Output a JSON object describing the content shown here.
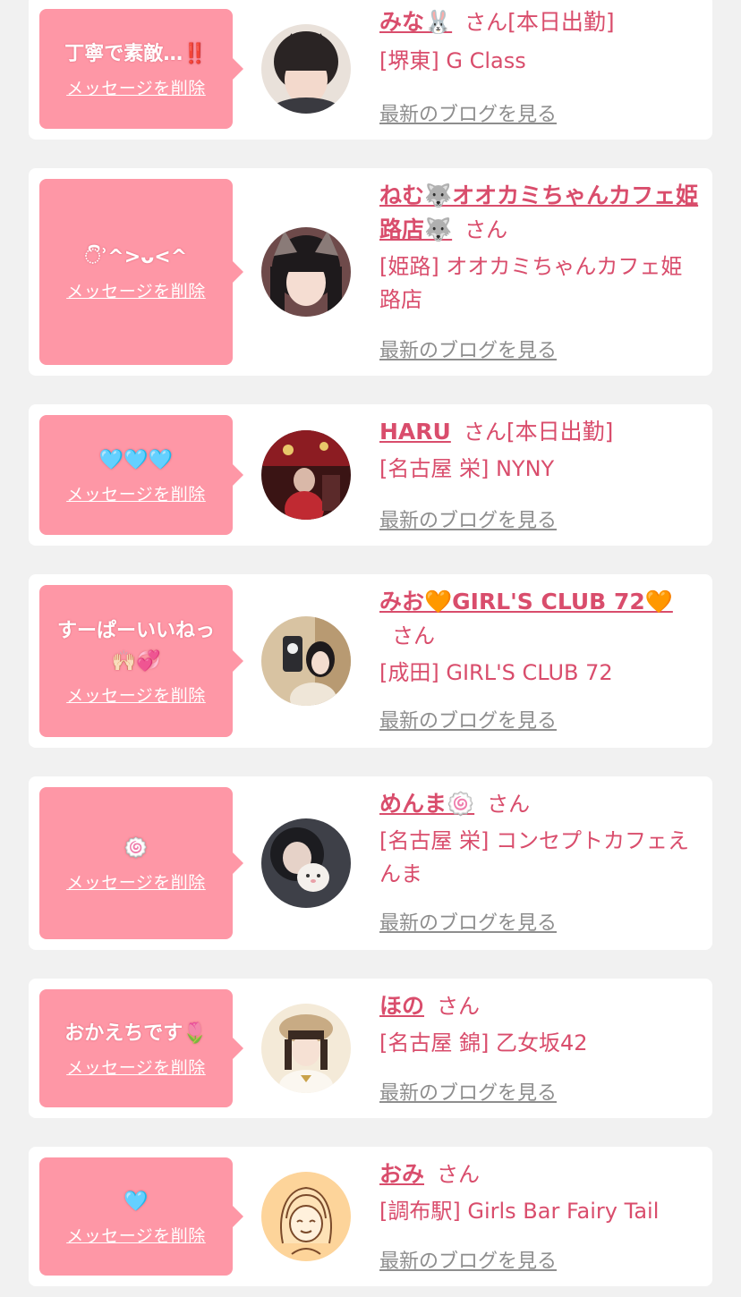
{
  "delete_label": "メッセージを削除",
  "blog_label": "最新のブログを見る",
  "san_label": "さん",
  "colors": {
    "background": "#f1f1f1",
    "card": "#ffffff",
    "bubble": "#fe97a6",
    "accent": "#d94d6c",
    "link_gray": "#8e8e8e"
  },
  "entries": [
    {
      "message": "丁寧で素敵…‼️",
      "name": "みな🐰",
      "status": "[本日出勤]",
      "shop": "[堺東] G Class",
      "avatar_icon": "user-photo-icon"
    },
    {
      "message": "ිʾ^>ᴗ<^",
      "name": "ねむ🐺オオカミちゃんカフェ姫路店🐺",
      "status": "",
      "shop": "[姫路] オオカミちゃんカフェ姫路店",
      "avatar_icon": "user-photo-icon"
    },
    {
      "message": "🩵🩵🩵",
      "name": "HARU",
      "status": "[本日出勤]",
      "shop": "[名古屋 栄] NYNY",
      "avatar_icon": "user-photo-icon"
    },
    {
      "message": "すーぱーいいねっ🙌🏻💞",
      "name": "みお🧡GIRL'S CLUB 72🧡",
      "status": "",
      "shop": "[成田] GIRL'S CLUB 72",
      "avatar_icon": "user-photo-icon"
    },
    {
      "message": "🍥",
      "name": "めんま🍥",
      "status": "",
      "shop": "[名古屋 栄] コンセプトカフェえんま",
      "avatar_icon": "user-photo-icon"
    },
    {
      "message": "おかえちです🌷",
      "name": "ほの",
      "status": "",
      "shop": "[名古屋 錦] 乙女坂42",
      "avatar_icon": "user-photo-icon"
    },
    {
      "message": "🩵",
      "name": "おみ",
      "status": "",
      "shop": "[調布駅] Girls Bar Fairy Tail",
      "avatar_icon": "default-avatar-illustration-icon"
    }
  ]
}
